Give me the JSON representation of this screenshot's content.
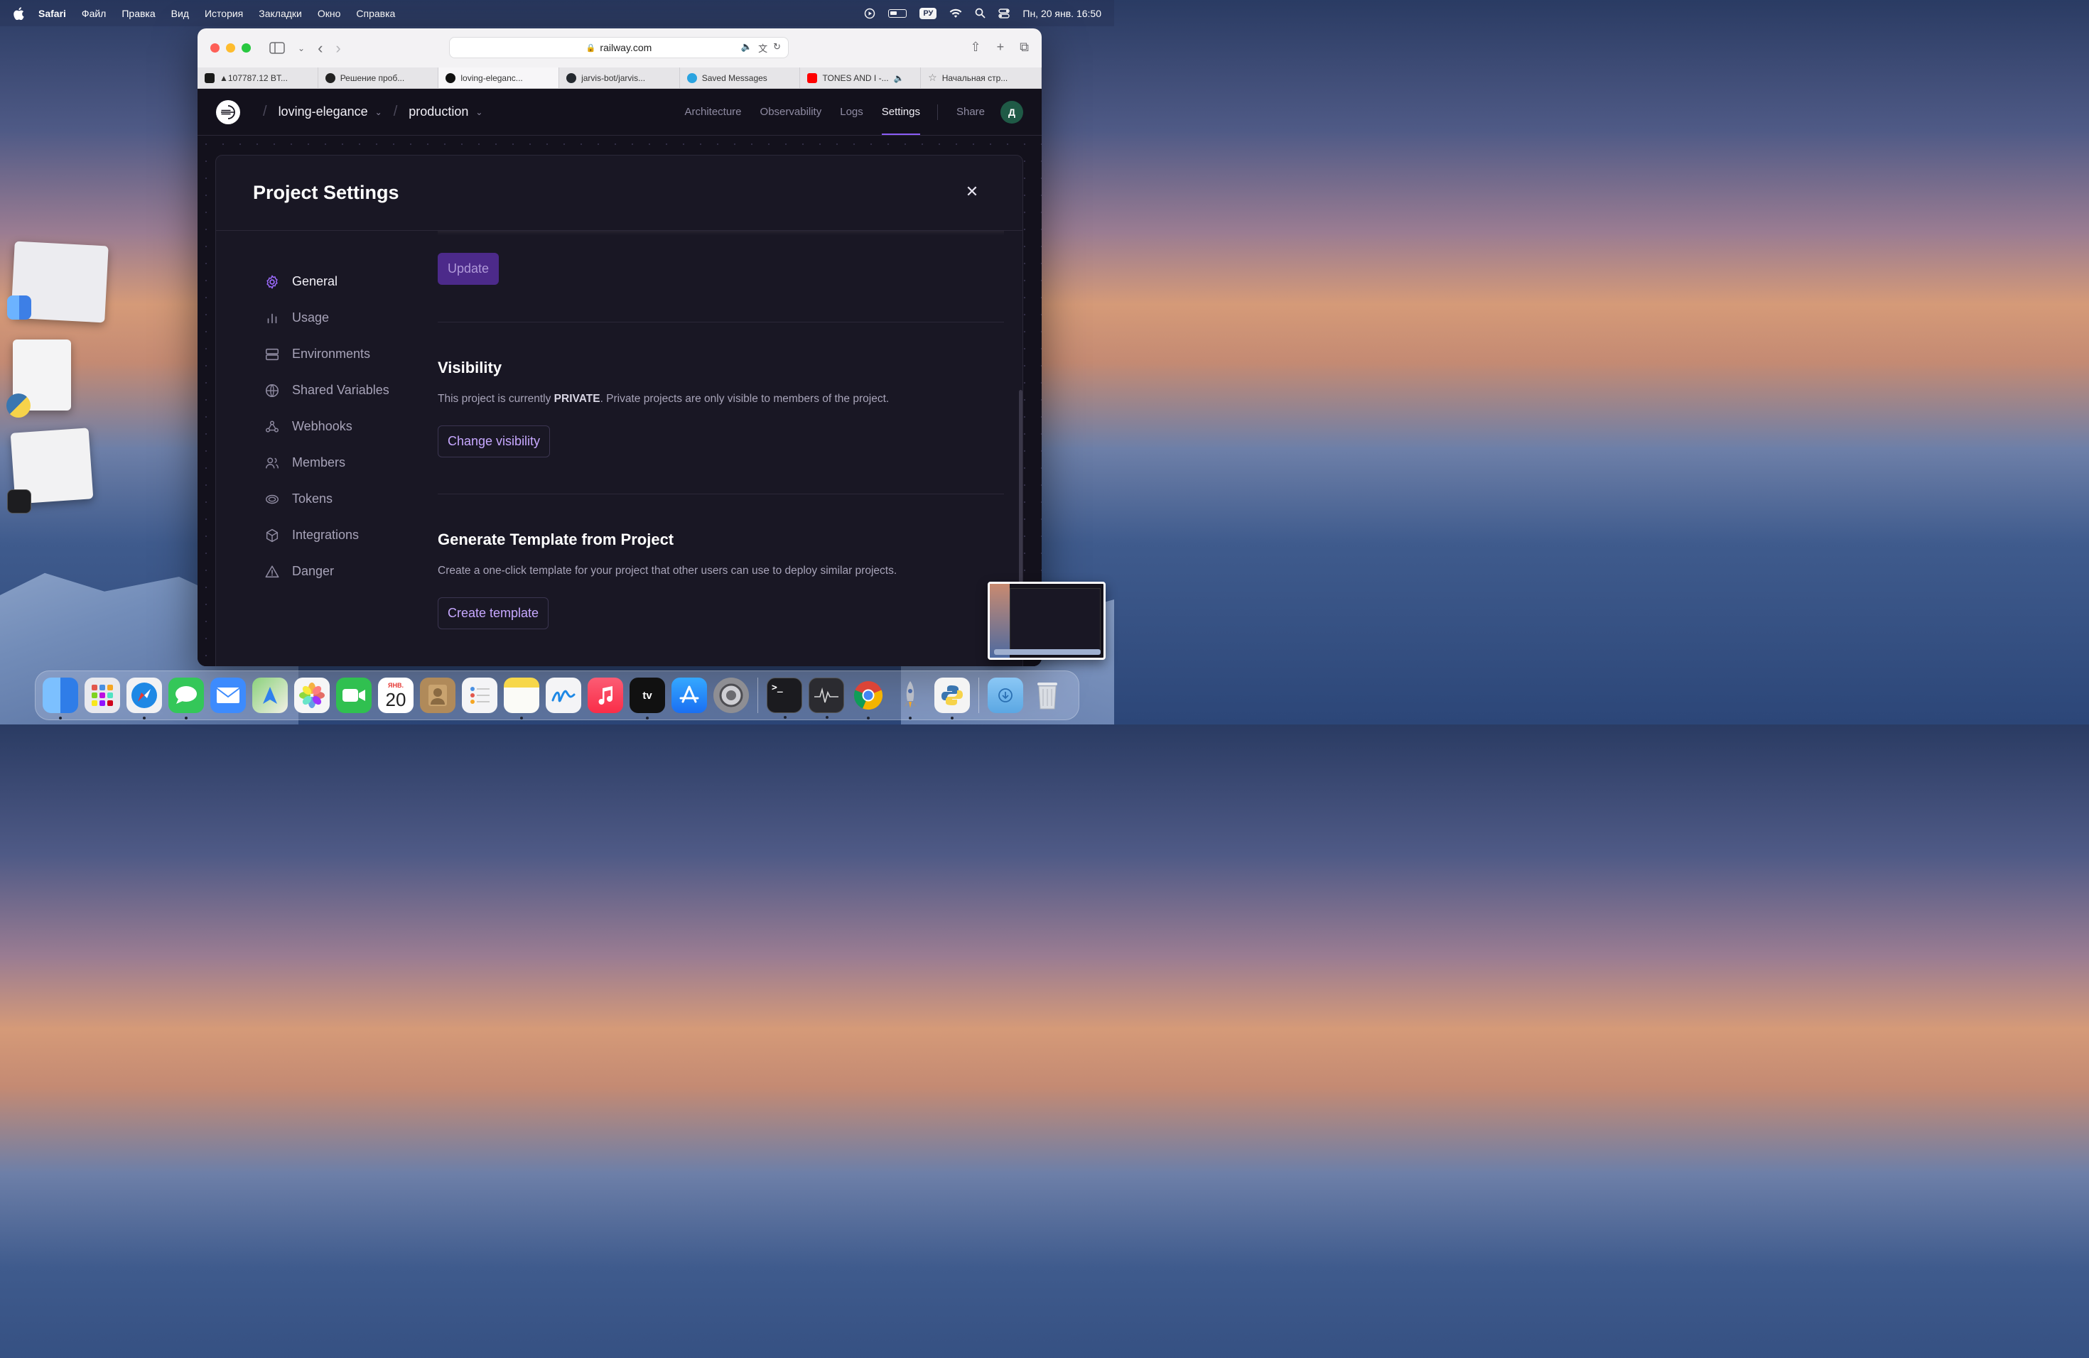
{
  "menubar": {
    "app_name": "Safari",
    "items": [
      "Файл",
      "Правка",
      "Вид",
      "История",
      "Закладки",
      "Окно",
      "Справка"
    ],
    "input_source": "РУ",
    "clock": "Пн, 20 янв.  16:50"
  },
  "browser": {
    "url": "railway.com",
    "tabs": [
      {
        "label": "▲107787.12 BT...",
        "favicon": "chart-favicon",
        "color": "#1a1a1a"
      },
      {
        "label": "Решение проб...",
        "favicon": "chatgpt-favicon",
        "color": "#222222"
      },
      {
        "label": "loving-eleganc...",
        "favicon": "railway-favicon",
        "color": "#111111",
        "active": true
      },
      {
        "label": "jarvis-bot/jarvis...",
        "favicon": "github-favicon",
        "color": "#24292f"
      },
      {
        "label": "Saved Messages",
        "favicon": "telegram-favicon",
        "color": "#2aa3e0"
      },
      {
        "label": "TONES AND I -...",
        "favicon": "youtube-favicon",
        "color": "#ff0000"
      },
      {
        "label": "Начальная стр...",
        "favicon": "star-favicon",
        "color": "#777777"
      }
    ]
  },
  "railway": {
    "project": "loving-elegance",
    "environment": "production",
    "nav": {
      "architecture": "Architecture",
      "observability": "Observability",
      "logs": "Logs",
      "settings": "Settings",
      "share": "Share"
    },
    "avatar_initial": "Д"
  },
  "modal": {
    "title": "Project Settings",
    "sidebar": {
      "general": "General",
      "usage": "Usage",
      "environments": "Environments",
      "shared_variables": "Shared Variables",
      "webhooks": "Webhooks",
      "members": "Members",
      "tokens": "Tokens",
      "integrations": "Integrations",
      "danger": "Danger"
    },
    "update_label": "Update",
    "visibility": {
      "title": "Visibility",
      "text_before": "This project is currently ",
      "status": "PRIVATE",
      "text_after": ". Private projects are only visible to members of the project.",
      "button": "Change visibility"
    },
    "template": {
      "title": "Generate Template from Project",
      "text": "Create a one-click template for your project that other users can use to deploy similar projects.",
      "button": "Create template"
    }
  },
  "dock": {
    "calendar": {
      "month": "ЯНВ.",
      "day": "20"
    },
    "apps": [
      {
        "name": "finder-icon",
        "color": "#3a8ef5",
        "running": true
      },
      {
        "name": "launchpad-icon",
        "color": "#e9e9ee",
        "running": false
      },
      {
        "name": "safari-icon",
        "color": "#1e88e5",
        "running": true
      },
      {
        "name": "messages-icon",
        "color": "#34c759",
        "running": true
      },
      {
        "name": "mail-icon",
        "color": "#3d8bfd",
        "running": false
      },
      {
        "name": "maps-icon",
        "color": "#5ac26a",
        "running": false
      },
      {
        "name": "photos-icon",
        "color": "#f6f6f6",
        "running": false
      },
      {
        "name": "facetime-icon",
        "color": "#30c050",
        "running": false
      },
      {
        "name": "calendar-icon",
        "color": "#ffffff",
        "running": false
      },
      {
        "name": "contacts-icon",
        "color": "#b08a5a",
        "running": false
      },
      {
        "name": "reminders-icon",
        "color": "#f4f4f6",
        "running": false
      },
      {
        "name": "notes-icon",
        "color": "#f7d74a",
        "running": true
      },
      {
        "name": "freeform-icon",
        "color": "#f4f4f6",
        "running": false
      },
      {
        "name": "music-icon",
        "color": "#fa3c4c",
        "running": false
      },
      {
        "name": "tv-icon",
        "color": "#111111",
        "running": true
      },
      {
        "name": "app-store-icon",
        "color": "#1a8cff",
        "running": false
      },
      {
        "name": "system-settings-icon",
        "color": "#8e8e93",
        "running": false
      },
      {
        "name": "separator",
        "color": "",
        "running": false
      },
      {
        "name": "terminal-icon",
        "color": "#1b1b1f",
        "running": true
      },
      {
        "name": "activity-monitor-icon",
        "color": "#2b2b30",
        "running": true
      },
      {
        "name": "chrome-icon",
        "color": "#f1f1f1",
        "running": true
      },
      {
        "name": "rocket-icon",
        "color": "transparent",
        "running": true
      },
      {
        "name": "python-launcher-icon",
        "color": "#f4f4f4",
        "running": true
      },
      {
        "name": "separator",
        "color": "",
        "running": false
      },
      {
        "name": "downloads-folder-icon",
        "color": "#6fb4ea",
        "running": false
      },
      {
        "name": "trash-icon",
        "color": "#d9dde3",
        "running": false
      }
    ]
  }
}
